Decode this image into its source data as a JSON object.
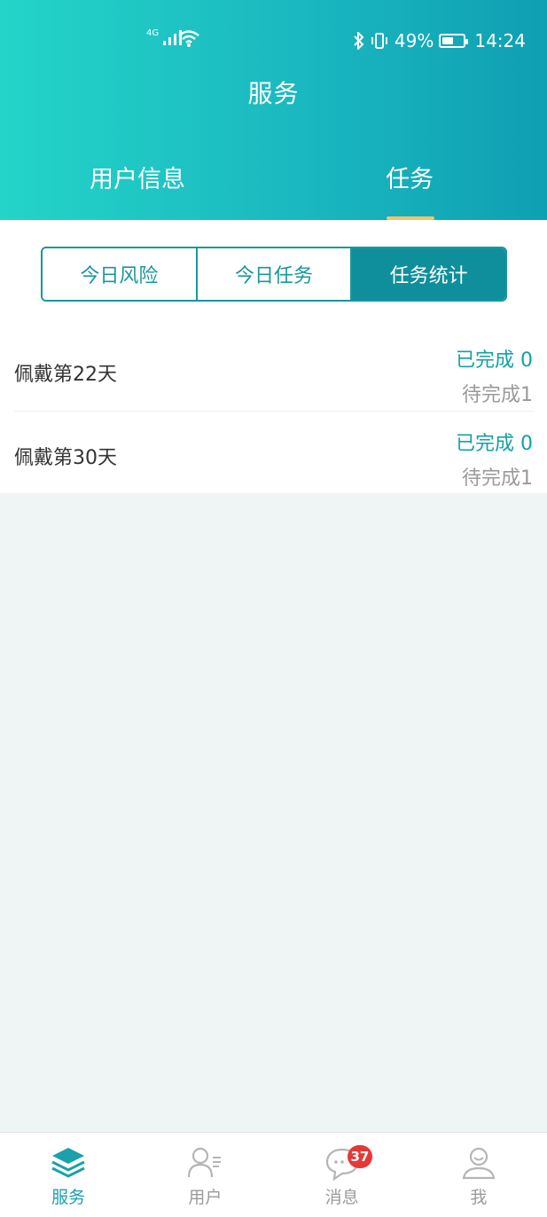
{
  "status_bar": {
    "network": "4G",
    "battery": "49%",
    "time": "14:24"
  },
  "header": {
    "title": "服务",
    "tabs": [
      {
        "label": "用户信息",
        "active": false
      },
      {
        "label": "任务",
        "active": true
      }
    ]
  },
  "segments": [
    {
      "label": "今日风险",
      "active": false
    },
    {
      "label": "今日任务",
      "active": false
    },
    {
      "label": "任务统计",
      "active": true
    }
  ],
  "tasks": [
    {
      "name": "佩戴第22天",
      "done": "已完成 0",
      "pending": "待完成1"
    },
    {
      "name": "佩戴第30天",
      "done": "已完成 0",
      "pending": "待完成1"
    }
  ],
  "bottom_nav": [
    {
      "label": "服务",
      "icon": "layers-icon",
      "active": true
    },
    {
      "label": "用户",
      "icon": "user-list-icon",
      "active": false
    },
    {
      "label": "消息",
      "icon": "chat-bubble-icon",
      "active": false,
      "badge": "37"
    },
    {
      "label": "我",
      "icon": "profile-icon",
      "active": false
    }
  ],
  "colors": {
    "accent": "#1aa1ab",
    "header_gradient_start": "#24d4c8",
    "header_gradient_end": "#0f9fb3",
    "tab_indicator": "#f2c46a",
    "badge": "#e53935"
  }
}
